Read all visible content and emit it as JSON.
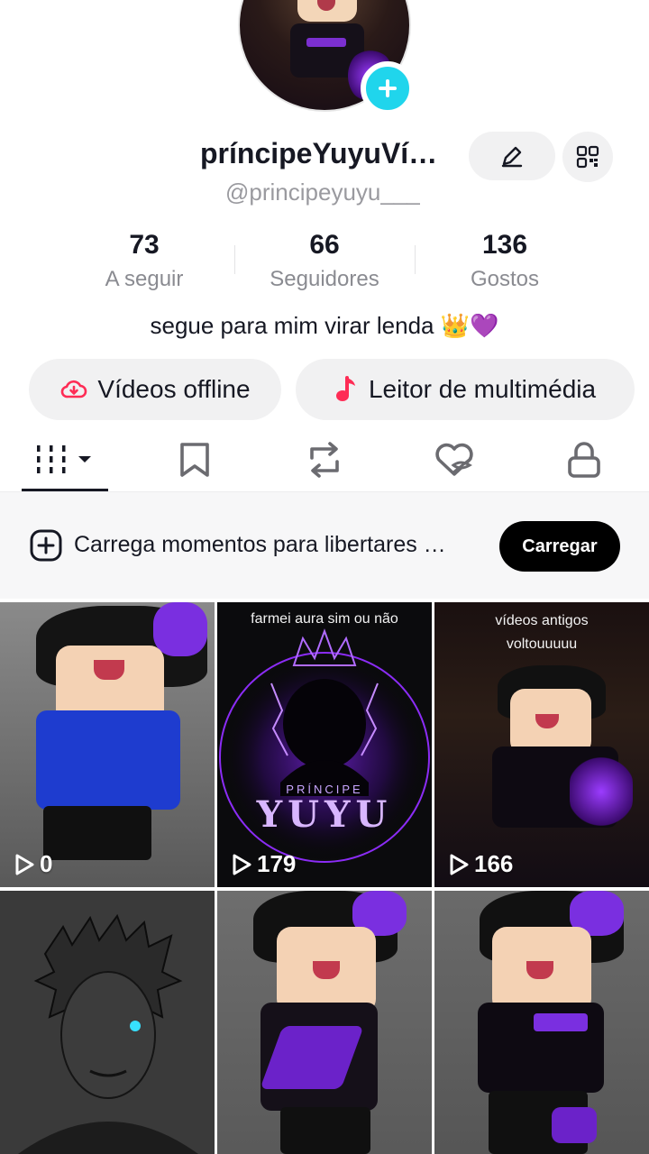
{
  "profile": {
    "display_name": "príncipeYuyuVí…",
    "handle": "@principeyuyu___",
    "bio": "segue para mim virar lenda 👑💜"
  },
  "stats": [
    {
      "value": "73",
      "label": "A seguir"
    },
    {
      "value": "66",
      "label": "Seguidores"
    },
    {
      "value": "136",
      "label": "Gostos"
    }
  ],
  "actions": {
    "offline_label": "Vídeos offline",
    "media_label": "Leitor de multimédia"
  },
  "tabs": [
    {
      "icon": "grid-icon",
      "active": true
    },
    {
      "icon": "bookmark-icon",
      "active": false
    },
    {
      "icon": "repost-icon",
      "active": false
    },
    {
      "icon": "liked-hidden-icon",
      "active": false
    },
    {
      "icon": "lock-icon",
      "active": false
    }
  ],
  "upload_banner": {
    "text": "Carrega momentos para libertares …",
    "button_label": "Carregar"
  },
  "videos": [
    {
      "views": "0",
      "caption": ""
    },
    {
      "views": "179",
      "caption": "farmei aura sim ou não",
      "art_text_top": "PRÍNCIPE",
      "art_text_main": "YUYU"
    },
    {
      "views": "166",
      "caption_line1": "vídeos antigos",
      "caption_line2": "voltouuuuu"
    },
    {
      "views": "",
      "caption": ""
    },
    {
      "views": "",
      "caption": ""
    },
    {
      "views": "",
      "caption": ""
    }
  ],
  "colors": {
    "accent_cyan": "#20d5ec",
    "offline_icon": "#fe2c55",
    "media_icon": "#fe2c55",
    "purple": "#8b2cf5"
  }
}
